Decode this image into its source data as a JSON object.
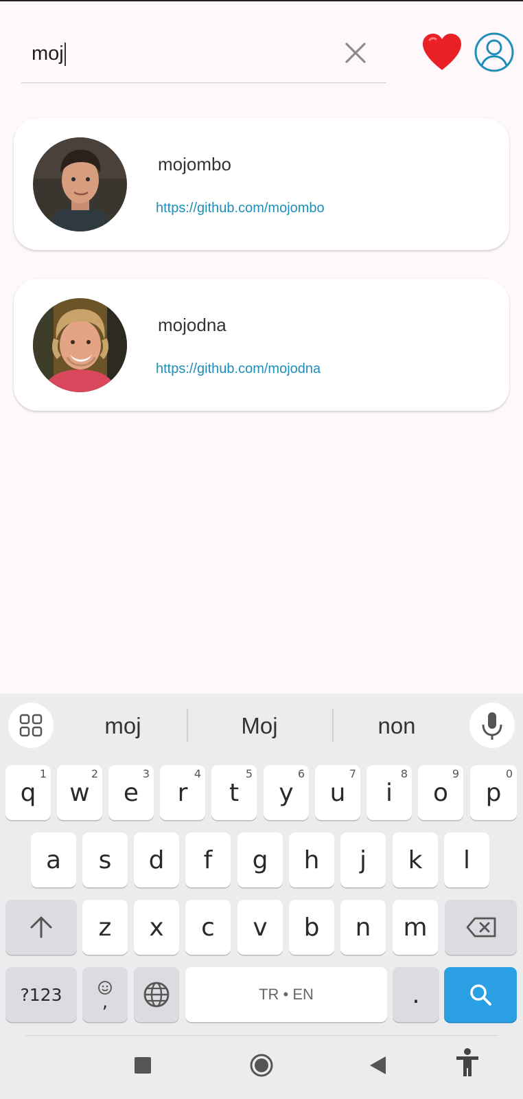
{
  "search": {
    "value": "moj",
    "placeholder": ""
  },
  "header": {
    "favorites_icon": "heart-icon",
    "account_icon": "account-circle-icon",
    "clear_icon": "close-icon"
  },
  "results": [
    {
      "username": "mojombo",
      "url": "https://github.com/mojombo",
      "avatar": "avatar-photo"
    },
    {
      "username": "mojodna",
      "url": "https://github.com/mojodna",
      "avatar": "avatar-photo"
    }
  ],
  "keyboard": {
    "suggestions": [
      "moj",
      "Moj",
      "non"
    ],
    "row1": [
      {
        "key": "q",
        "hint": "1"
      },
      {
        "key": "w",
        "hint": "2"
      },
      {
        "key": "e",
        "hint": "3"
      },
      {
        "key": "r",
        "hint": "4"
      },
      {
        "key": "t",
        "hint": "5"
      },
      {
        "key": "y",
        "hint": "6"
      },
      {
        "key": "u",
        "hint": "7"
      },
      {
        "key": "i",
        "hint": "8"
      },
      {
        "key": "o",
        "hint": "9"
      },
      {
        "key": "p",
        "hint": "0"
      }
    ],
    "row2": [
      "a",
      "s",
      "d",
      "f",
      "g",
      "h",
      "j",
      "k",
      "l"
    ],
    "row3": [
      "z",
      "x",
      "c",
      "v",
      "b",
      "n",
      "m"
    ],
    "symbols_label": "?123",
    "comma_label": ",",
    "space_label": "TR • EN",
    "period_label": "."
  },
  "colors": {
    "accent": "#1d8eb8",
    "heart": "#ea2027",
    "search_key": "#2a9fe3"
  }
}
